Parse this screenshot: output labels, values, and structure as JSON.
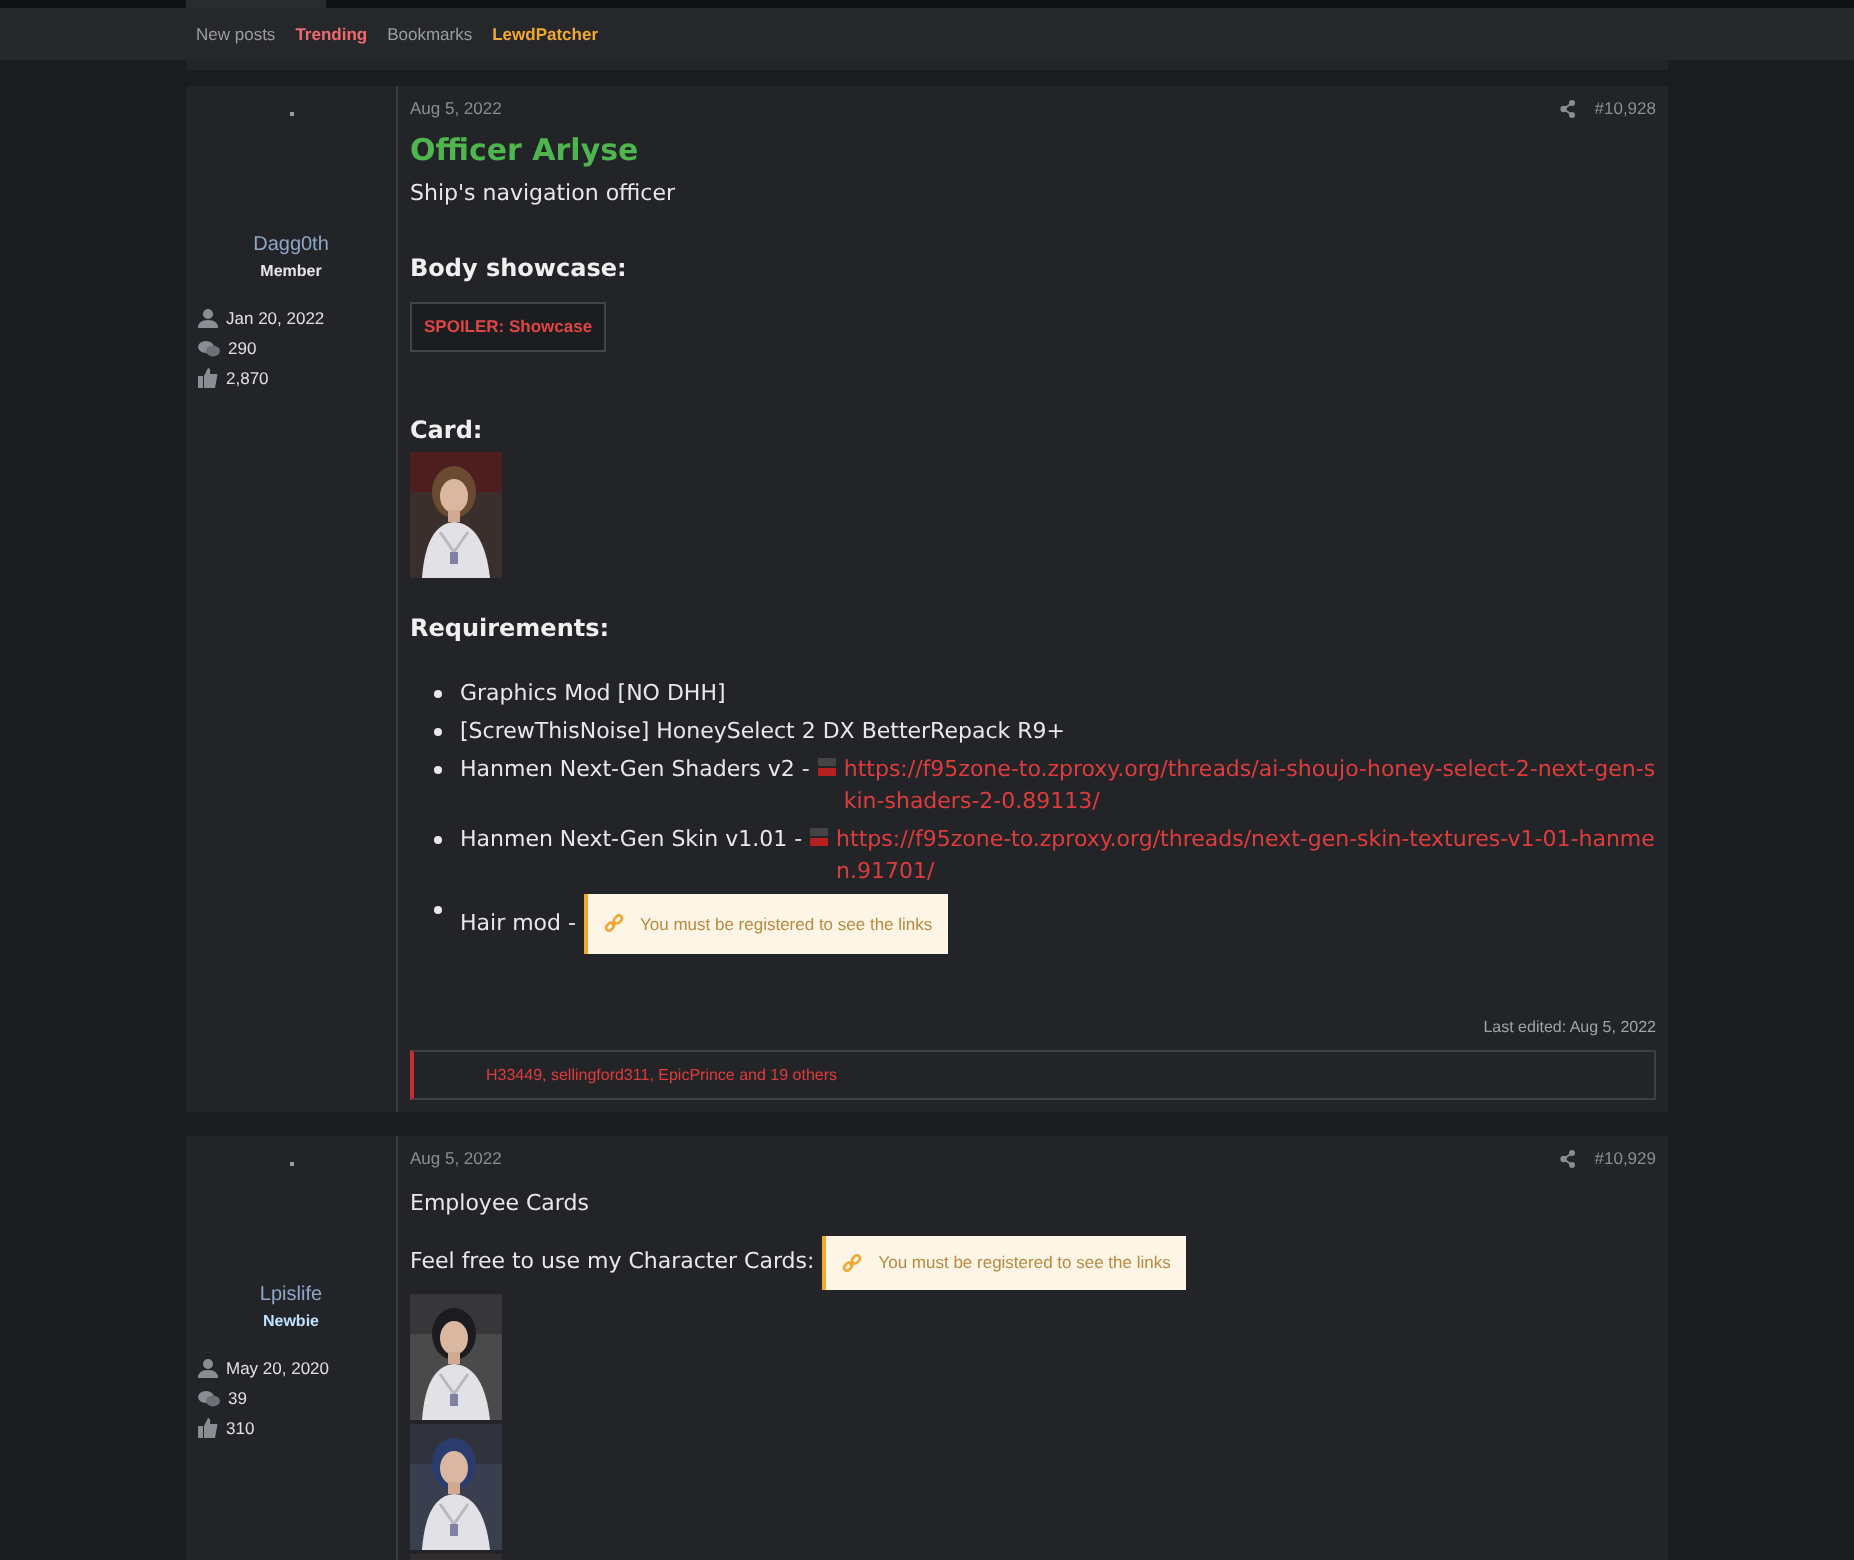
{
  "nav": [
    {
      "label": "New posts",
      "color": "#9a9ca0"
    },
    {
      "label": "Trending",
      "color": "#f0696e"
    },
    {
      "label": "Bookmarks",
      "color": "#9a9ca0"
    },
    {
      "label": "LewdPatcher",
      "color": "#f0a830"
    }
  ],
  "posts": [
    {
      "author": {
        "name": "Dagg0th",
        "role": "Member",
        "kind": "member"
      },
      "stats": [
        {
          "kind": "joined",
          "text": "Jan 20, 2022"
        },
        {
          "kind": "messages",
          "text": "290"
        },
        {
          "kind": "reactions",
          "text": "2,870"
        }
      ],
      "date": "Aug 5, 2022",
      "number": "#10,928",
      "body": [
        {
          "kind": "title",
          "text": "Officer Arlyse"
        },
        {
          "kind": "text",
          "text": "Ship's navigation officer"
        },
        {
          "kind": "heading",
          "text": "Body showcase:"
        },
        {
          "kind": "spoiler",
          "text": "SPOILER: Showcase"
        },
        {
          "kind": "heading",
          "text": "Card:"
        },
        {
          "kind": "pictures"
        },
        {
          "kind": "heading",
          "text": "Requirements:"
        },
        {
          "kind": "list",
          "items": [
            {
              "text": "Graphics Mod [NO DHH]"
            },
            {
              "text": "[ScrewThisNoise] HoneySelect 2 DX BetterRepack R9+"
            },
            {
              "text": "Hanmen Next-Gen Shaders v2 -",
              "link": "https://f95zone-to.zproxy.org/threads/ai-shoujo-honey-select-2-next-gen-skin-shaders-2-0.89113/"
            },
            {
              "text": "Hanmen Next-Gen Skin v1.01 -",
              "link": "https://f95zone-to.zproxy.org/threads/next-gen-skin-textures-v1-01-hanmen.91701/"
            },
            {
              "text": "Hair mod -",
              "notice": "You must be registered to see the links"
            }
          ]
        }
      ],
      "last_edited": "Last edited: Aug 5, 2022",
      "reactions": "H33449, sellingford311, EpicPrince and 19 others"
    },
    {
      "author": {
        "name": "Lpislife",
        "role": "Newbie",
        "kind": "newbie"
      },
      "stats": [
        {
          "kind": "joined",
          "text": "May 20, 2020"
        },
        {
          "kind": "messages",
          "text": "39"
        },
        {
          "kind": "reactions",
          "text": "310"
        }
      ],
      "date": "Aug 5, 2022",
      "number": "#10,929",
      "body": [
        {
          "kind": "text",
          "text": "Employee Cards"
        },
        {
          "kind": "notice_line",
          "text": "Feel free to use my Character Cards:",
          "notice": "You must be registered to see the links"
        },
        {
          "kind": "pictures"
        }
      ]
    }
  ]
}
